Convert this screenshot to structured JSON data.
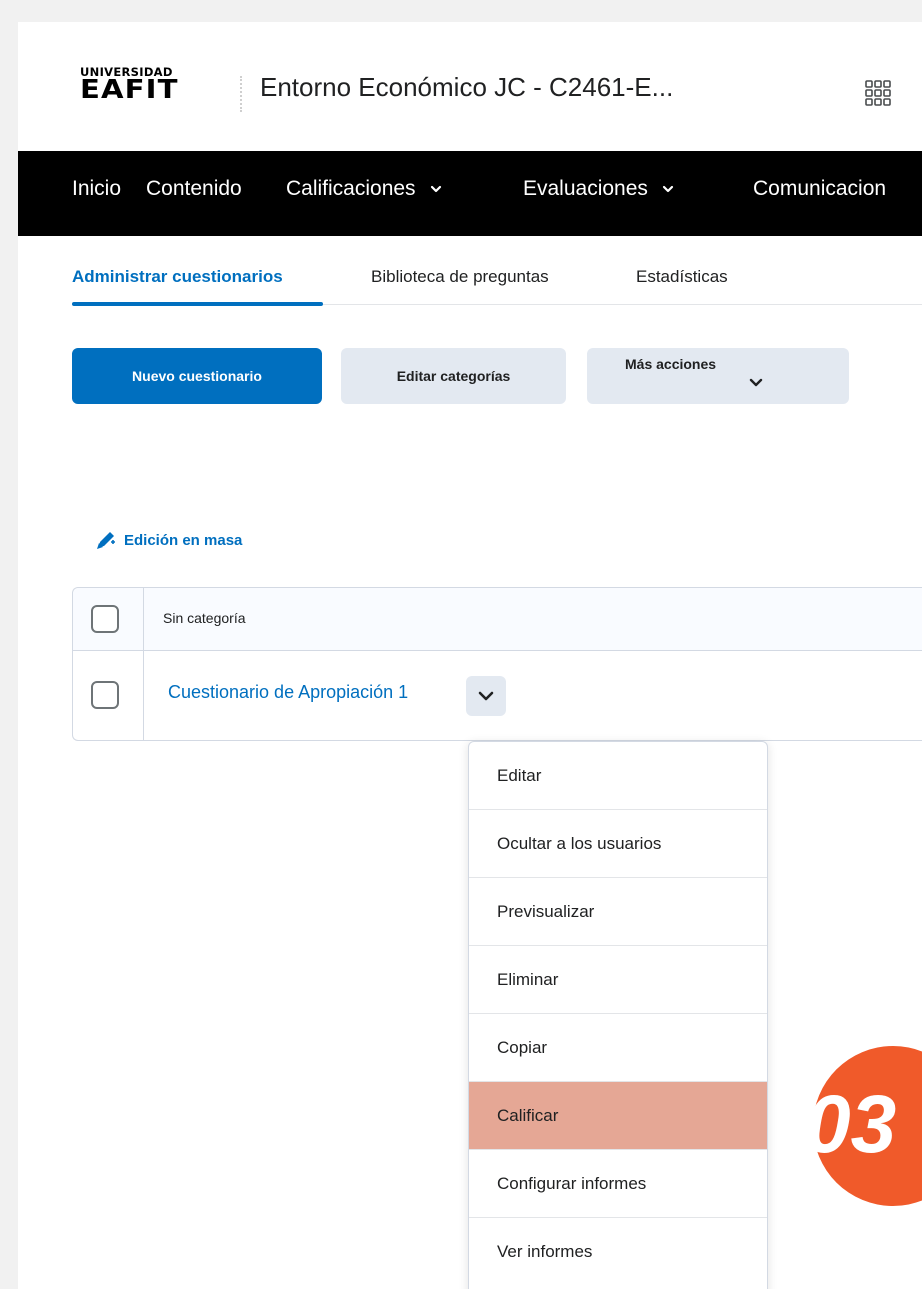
{
  "header": {
    "logo_line1": "UNIVERSIDAD",
    "logo_line2": "EAFIT",
    "course_title": "Entorno Económico JC - C2461-E...",
    "apps_icon": "grid-9-icon"
  },
  "navbar": {
    "items": [
      {
        "label": "Inicio",
        "dropdown": false
      },
      {
        "label": "Contenido",
        "dropdown": false
      },
      {
        "label": "Calificaciones",
        "dropdown": true
      },
      {
        "label": "Evaluaciones",
        "dropdown": true
      },
      {
        "label": "Comunicacion",
        "dropdown": false
      }
    ]
  },
  "tabs": {
    "items": [
      {
        "label": "Administrar cuestionarios",
        "active": true
      },
      {
        "label": "Biblioteca de preguntas",
        "active": false
      },
      {
        "label": "Estadísticas",
        "active": false
      }
    ]
  },
  "toolbar": {
    "new_quiz": "Nuevo cuestionario",
    "edit_categories": "Editar categorías",
    "more_actions": "Más acciones"
  },
  "bulk_edit": {
    "label": "Edición en masa",
    "icon": "pencil-icon"
  },
  "table": {
    "category_header": "Sin categoría",
    "rows": [
      {
        "title": "Cuestionario de Apropiación 1"
      }
    ]
  },
  "context_menu": {
    "items": [
      {
        "label": "Editar",
        "highlighted": false
      },
      {
        "label": "Ocultar a los usuarios",
        "highlighted": false
      },
      {
        "label": "Previsualizar",
        "highlighted": false
      },
      {
        "label": "Eliminar",
        "highlighted": false
      },
      {
        "label": "Copiar",
        "highlighted": false
      },
      {
        "label": "Calificar",
        "highlighted": true
      },
      {
        "label": "Configurar informes",
        "highlighted": false
      },
      {
        "label": "Ver informes",
        "highlighted": false
      }
    ]
  },
  "step_badge": {
    "text": "03",
    "color": "#f05a2a"
  },
  "colors": {
    "accent": "#006fbf",
    "navbar_bg": "#000000",
    "highlight": "#e5a795"
  }
}
